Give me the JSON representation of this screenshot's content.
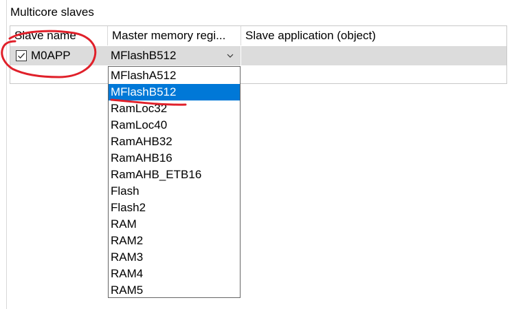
{
  "group": {
    "title": "Multicore slaves"
  },
  "table": {
    "columns": [
      "Slave name",
      "Master memory regi...",
      "Slave application (object)"
    ],
    "row": {
      "checked": true,
      "slave_name": "M0APP",
      "master_memory_region": "MFlashB512",
      "slave_application": ""
    }
  },
  "dropdown": {
    "selected_index": 1,
    "options": [
      "MFlashA512",
      "MFlashB512",
      "RamLoc32",
      "RamLoc40",
      "RamAHB32",
      "RamAHB16",
      "RamAHB_ETB16",
      "Flash",
      "Flash2",
      "RAM",
      "RAM2",
      "RAM3",
      "RAM4",
      "RAM5"
    ]
  },
  "colors": {
    "selection": "#0078d7",
    "row_background": "#dcdcdc",
    "annotation": "#e0202a"
  },
  "icons": {
    "checkbox": "check-icon",
    "combo": "chevron-down-icon"
  }
}
